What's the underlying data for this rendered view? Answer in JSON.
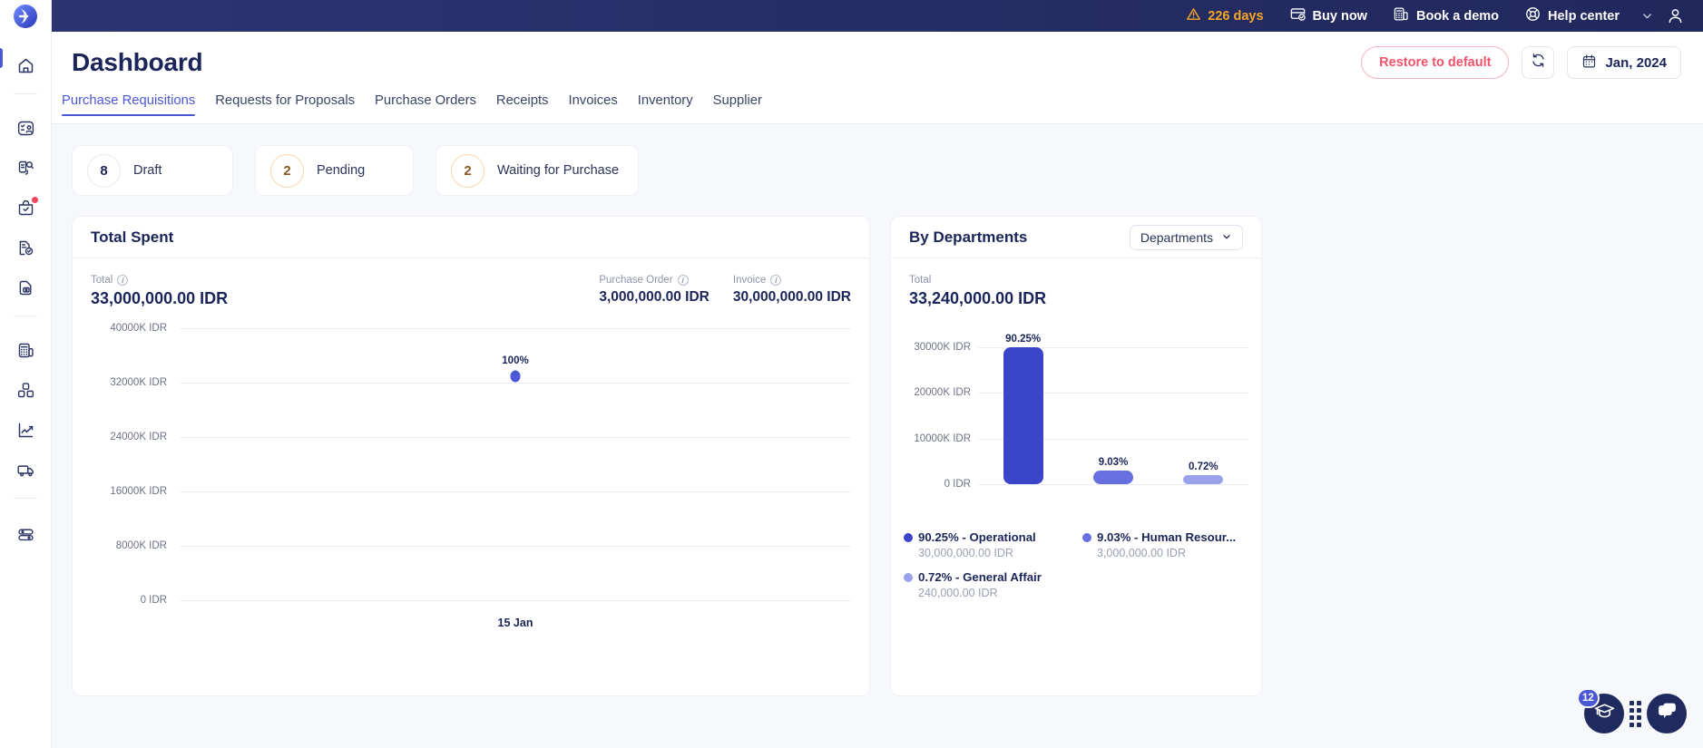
{
  "topbar": {
    "trial": {
      "label": "226 days",
      "icon": "warning-triangle-icon",
      "color": "#f5a623"
    },
    "buy_now": "Buy now",
    "book_demo": "Book a demo",
    "help_center": "Help center"
  },
  "header": {
    "title": "Dashboard",
    "restore_label": "Restore to default",
    "refresh_icon": "refresh-icon",
    "date_label": "Jan, 2024"
  },
  "tabs": [
    {
      "label": "Purchase Requisitions",
      "active": true
    },
    {
      "label": "Requests for Proposals",
      "active": false
    },
    {
      "label": "Purchase Orders",
      "active": false
    },
    {
      "label": "Receipts",
      "active": false
    },
    {
      "label": "Invoices",
      "active": false
    },
    {
      "label": "Inventory",
      "active": false
    },
    {
      "label": "Supplier",
      "active": false
    }
  ],
  "status_cards": [
    {
      "count": "8",
      "label": "Draft",
      "tone": "grey"
    },
    {
      "count": "2",
      "label": "Pending",
      "tone": "amber"
    },
    {
      "count": "2",
      "label": "Waiting for Purchase",
      "tone": "amber"
    }
  ],
  "total_spent": {
    "title": "Total Spent",
    "metrics": [
      {
        "label": "Total",
        "value": "33,000,000.00 IDR"
      },
      {
        "label": "Purchase Order",
        "value": "3,000,000.00 IDR"
      },
      {
        "label": "Invoice",
        "value": "30,000,000.00 IDR"
      }
    ]
  },
  "by_departments": {
    "title": "By Departments",
    "dropdown": "Departments",
    "total_label": "Total",
    "total_value": "33,240,000.00 IDR",
    "legend": [
      {
        "percent": "90.25%",
        "name": "Operational",
        "text": "90.25% - Operational",
        "amount": "30,000,000.00 IDR",
        "color": "#3b45c9"
      },
      {
        "percent": "9.03%",
        "name": "Human Resour...",
        "text": "9.03% - Human Resour...",
        "amount": "3,000,000.00 IDR",
        "color": "#6670e0"
      },
      {
        "percent": "0.72%",
        "name": "General Affair",
        "text": "0.72% - General Affair",
        "amount": "240,000.00 IDR",
        "color": "#9aa2ec"
      }
    ]
  },
  "chart_data": [
    {
      "type": "line",
      "title": "Total Spent",
      "x": [
        "15 Jan"
      ],
      "xlabel": "",
      "ylabel": "",
      "ytick_labels": [
        "40000K IDR",
        "32000K IDR",
        "24000K IDR",
        "16000K IDR",
        "8000K IDR",
        "0 IDR"
      ],
      "ytick_values": [
        40000,
        32000,
        24000,
        16000,
        8000,
        0
      ],
      "ylim": [
        0,
        40000
      ],
      "unit": "K IDR",
      "grid": true,
      "legend": "none",
      "series": [
        {
          "name": "Total Spent",
          "values": [
            33000
          ],
          "point_labels": [
            "100%"
          ],
          "color": "#4a58d6"
        }
      ]
    },
    {
      "type": "bar",
      "title": "By Departments",
      "categories": [
        "Operational",
        "Human Resource",
        "General Affair"
      ],
      "values": [
        30000,
        3000,
        240
      ],
      "data_labels": [
        "90.25%",
        "9.03%",
        "0.72%"
      ],
      "amounts": [
        "30,000,000.00 IDR",
        "3,000,000.00 IDR",
        "240,000.00 IDR"
      ],
      "colors": [
        "#3b45c9",
        "#6670e0",
        "#9aa2ec"
      ],
      "ytick_labels": [
        "30000K IDR",
        "20000K IDR",
        "10000K IDR",
        "0 IDR"
      ],
      "ytick_values": [
        30000,
        20000,
        10000,
        0
      ],
      "ylim": [
        0,
        33000
      ],
      "unit": "K IDR",
      "grid": true,
      "legend": "bottom",
      "xlabel": "",
      "ylabel": ""
    }
  ],
  "sidebar": {
    "items": [
      {
        "icon": "home-icon",
        "name": "home"
      },
      {
        "icon": "requisition-icon",
        "name": "requisitions"
      },
      {
        "icon": "proposal-search-icon",
        "name": "requests-for-proposals"
      },
      {
        "icon": "purchase-order-icon",
        "name": "purchase-orders",
        "badge": true
      },
      {
        "icon": "receipt-check-icon",
        "name": "receipts"
      },
      {
        "icon": "invoice-icon",
        "name": "invoices"
      },
      {
        "icon": "calculator-icon",
        "name": "accounting"
      },
      {
        "icon": "inventory-boxes-icon",
        "name": "inventory"
      },
      {
        "icon": "analytics-chart-icon",
        "name": "analytics"
      },
      {
        "icon": "delivery-truck-icon",
        "name": "delivery"
      },
      {
        "icon": "toggles-icon",
        "name": "settings"
      }
    ]
  },
  "fabs": {
    "learning_badge": "12",
    "learning_icon": "graduation-cap-icon",
    "apps_icon": "apps-grid-icon",
    "chat_icon": "chat-bubbles-icon"
  }
}
